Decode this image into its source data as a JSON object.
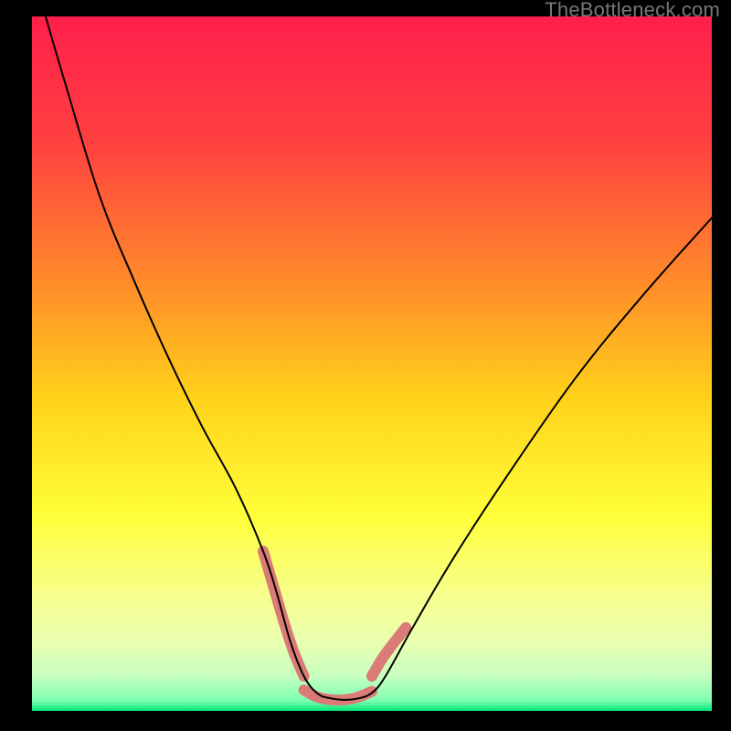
{
  "watermark": "TheBottleneck.com",
  "chart_data": {
    "type": "line",
    "title": "",
    "xlabel": "",
    "ylabel": "",
    "xlim": [
      0,
      100
    ],
    "ylim": [
      0,
      100
    ],
    "background_gradient_stops": [
      {
        "offset": 0.0,
        "color": "#ff1f4b"
      },
      {
        "offset": 0.18,
        "color": "#ff4040"
      },
      {
        "offset": 0.38,
        "color": "#ff8a2a"
      },
      {
        "offset": 0.55,
        "color": "#ffd21a"
      },
      {
        "offset": 0.72,
        "color": "#ffff3a"
      },
      {
        "offset": 0.83,
        "color": "#f7ff8a"
      },
      {
        "offset": 0.9,
        "color": "#eaffb0"
      },
      {
        "offset": 0.95,
        "color": "#c7ffc0"
      },
      {
        "offset": 0.985,
        "color": "#7dffb0"
      },
      {
        "offset": 1.0,
        "color": "#00e67a"
      }
    ],
    "series": [
      {
        "name": "bottleneck-curve",
        "stroke": "#000000",
        "stroke_width": 2,
        "x": [
          2,
          5,
          10,
          15,
          20,
          25,
          30,
          34,
          36,
          38,
          40,
          42,
          44,
          46,
          48,
          50,
          52,
          56,
          62,
          70,
          80,
          90,
          100
        ],
        "values": [
          100,
          90,
          74,
          62,
          51,
          41,
          32,
          23,
          17,
          10,
          5,
          2.5,
          1.8,
          1.6,
          1.8,
          2.6,
          5,
          12,
          22,
          34,
          48,
          60,
          71
        ]
      }
    ],
    "highlight_segments": [
      {
        "name": "left-descent-highlight",
        "stroke": "#da7b77",
        "stroke_width": 12,
        "x": [
          34,
          35.5,
          37,
          38.5,
          40
        ],
        "values": [
          23,
          18,
          13,
          8.5,
          5
        ]
      },
      {
        "name": "trough-highlight",
        "stroke": "#da7b77",
        "stroke_width": 12,
        "x": [
          40,
          42,
          44,
          46,
          48,
          50
        ],
        "values": [
          3.0,
          2.0,
          1.6,
          1.6,
          2.0,
          2.8
        ]
      },
      {
        "name": "right-ascent-highlight",
        "stroke": "#da7b77",
        "stroke_width": 12,
        "x": [
          50,
          51.5,
          53,
          55
        ],
        "values": [
          5,
          7.5,
          9.5,
          12
        ]
      }
    ]
  }
}
